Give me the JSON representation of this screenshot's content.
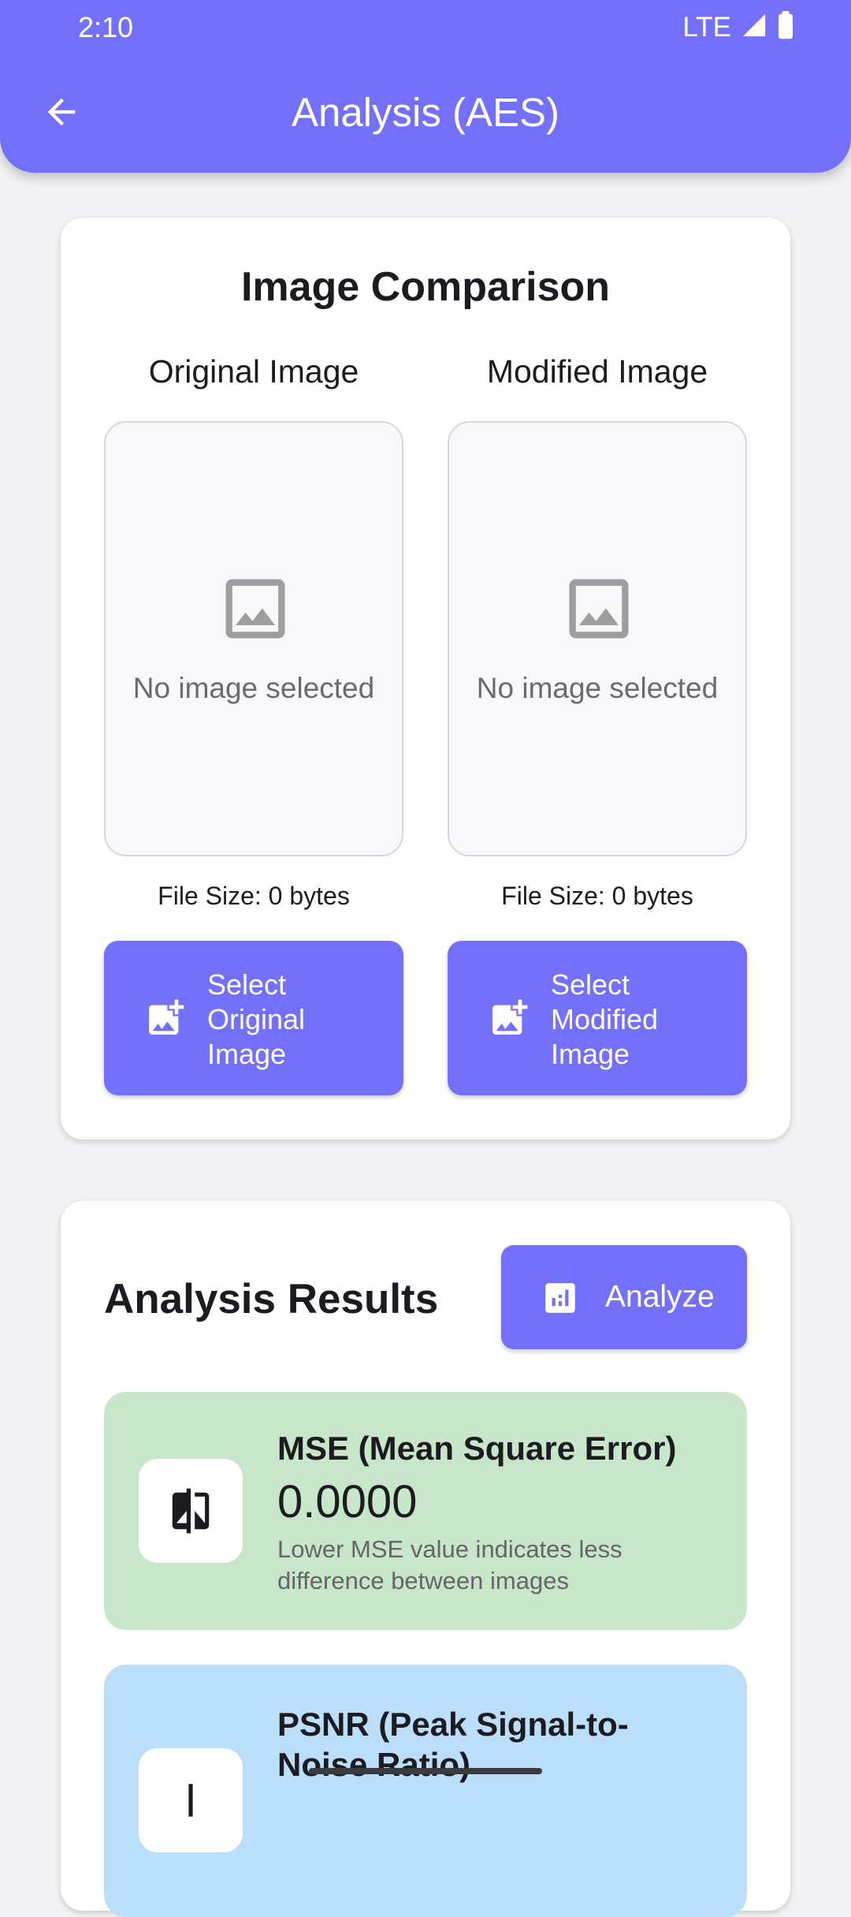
{
  "status_bar": {
    "time": "2:10",
    "network": "LTE"
  },
  "app_bar": {
    "title": "Analysis (AES)"
  },
  "comparison": {
    "title": "Image Comparison",
    "original": {
      "label": "Original Image",
      "placeholder": "No image selected",
      "file_size": "File Size: 0 bytes",
      "button_label": "Select Original Image"
    },
    "modified": {
      "label": "Modified Image",
      "placeholder": "No image selected",
      "file_size": "File Size: 0 bytes",
      "button_label": "Select Modified Image"
    }
  },
  "results": {
    "title": "Analysis Results",
    "analyze_label": "Analyze",
    "mse": {
      "name": "MSE (Mean Square Error)",
      "value": "0.0000",
      "description": "Lower MSE value indicates less difference between images",
      "color": "#c8e6c9"
    },
    "psnr": {
      "name": "PSNR (Peak Signal-to-Noise Ratio)",
      "color": "#bbdefb"
    }
  },
  "colors": {
    "accent": "#7470fe",
    "background": "#f2f1f3"
  },
  "icons": [
    "back-arrow-icon",
    "signal-icon",
    "battery-icon",
    "image-placeholder-icon",
    "add-photo-icon",
    "bar-chart-icon",
    "compare-icon"
  ]
}
